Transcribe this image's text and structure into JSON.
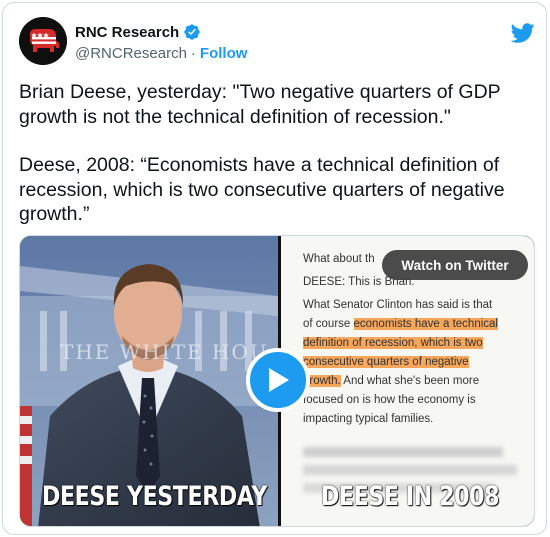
{
  "author": {
    "display_name": "RNC Research",
    "handle": "@RNCResearch",
    "separator": "·",
    "follow_label": "Follow"
  },
  "tweet": {
    "paragraph_1": "Brian Deese, yesterday: \"Two negative quarters of GDP growth is not the technical definition of recession.\"",
    "paragraph_2": "Deese, 2008: “Economists have a technical definition of recession, which is two consecutive quarters of negative growth.”"
  },
  "media": {
    "watch_label": "Watch on Twitter",
    "left_caption": "DEESE YESTERDAY",
    "right_caption": "DEESE IN 2008",
    "backdrop_text": "THE WHITE HOU",
    "transcript": {
      "line_1": "What about th",
      "line_2": "DEESE: This is Brian.",
      "line_3": "What Senator Clinton has said is that",
      "line_4_plain": "of course ",
      "line_4_highlight": "economists have a technical",
      "line_5_highlight": "definition of recession, which is two",
      "line_6_highlight": "consecutive quarters of negative",
      "line_7_highlight": "growth.",
      "line_7_plain": " And what she's been more",
      "line_8": "focused on is how the economy is",
      "line_9": "impacting typical families."
    }
  },
  "colors": {
    "accent": "#1d9bf0",
    "text": "#0f1419",
    "secondary_text": "#536471",
    "highlight": "#f7a65a"
  },
  "icons": {
    "avatar": "rnc-elephant-logo",
    "verified": "verified-badge-icon",
    "brand": "twitter-bird-icon",
    "play": "play-icon"
  }
}
